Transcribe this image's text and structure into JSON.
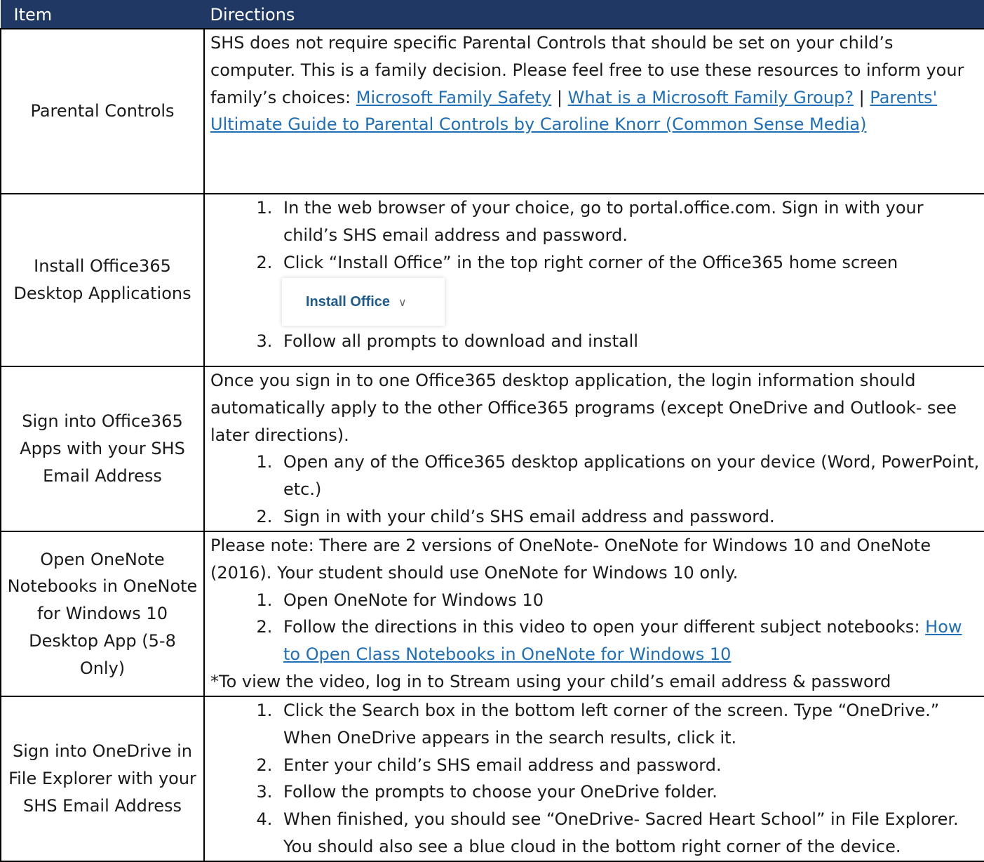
{
  "header": {
    "item": "Item",
    "directions": "Directions"
  },
  "rows": [
    {
      "item": "Parental Controls",
      "text_1": "SHS does not require specific Parental Controls that should be set on your child’s computer. This is a family decision. Please feel free to use these resources to inform your family’s choices: ",
      "links": [
        "Microsoft Family Safety",
        "What is a Microsoft Family Group?",
        "Parents' Ultimate Guide to Parental Controls by Caroline Knorr (Common Sense Media)"
      ],
      "separator": " | "
    },
    {
      "item": "Install Office365 Desktop Applications",
      "steps": [
        "In the web browser of your choice, go to portal.office.com. Sign in with your child’s SHS email address and password.",
        "Click “Install Office” in the top right corner of the Office365 home screen",
        "Follow all prompts to download and install"
      ],
      "button_label": "Install Office",
      "button_icon": "chevron-down-icon"
    },
    {
      "item": "Sign into Office365 Apps with your SHS Email Address",
      "intro": "Once you sign in to one Office365 desktop application, the login information should automatically apply to the other Office365 programs (except OneDrive and Outlook- see later directions).",
      "steps": [
        "Open any of the Office365 desktop applications on your device (Word, PowerPoint, etc.)",
        "Sign in with your child’s SHS email address and password."
      ]
    },
    {
      "item": "Open OneNote Notebooks in OneNote for Windows 10 Desktop App (5-8 Only)",
      "intro": "Please note: There are 2 versions of OneNote- OneNote for Windows 10 and OneNote (2016). Your student should use OneNote for Windows 10 only.",
      "steps": [
        "Open OneNote for Windows 10",
        "Follow the directions in this video to open your different subject notebooks: "
      ],
      "link": "How to Open Class Notebooks in OneNote for Windows 10",
      "note": "*To view the video, log in to Stream using your child’s email address & password"
    },
    {
      "item": "Sign into OneDrive in File Explorer with your SHS Email Address",
      "steps": [
        "Click the Search box in the bottom left corner of the screen. Type “OneDrive.” When OneDrive appears in the search results, click it.",
        "Enter your child’s SHS email address and password.",
        "Follow the prompts to choose your OneDrive folder.",
        "When finished, you should see “OneDrive- Sacred Heart School” in File Explorer. You should also see a blue cloud in the bottom right corner of the device."
      ]
    }
  ]
}
